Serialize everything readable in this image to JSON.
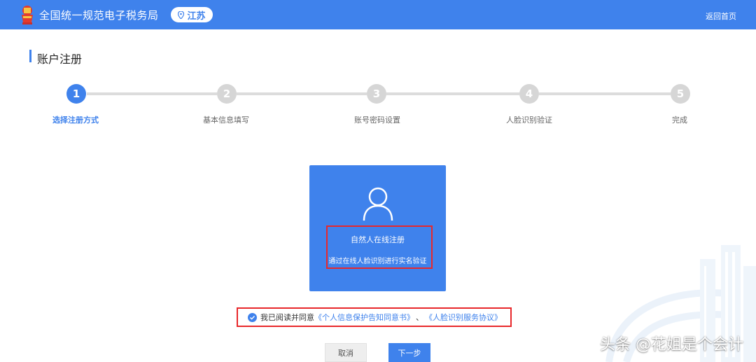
{
  "header": {
    "site_title": "全国统一规范电子税务局",
    "region": "江苏",
    "home_link": "返回首页"
  },
  "page": {
    "title": "账户注册"
  },
  "steps": [
    {
      "number": "1",
      "label": "选择注册方式",
      "active": true
    },
    {
      "number": "2",
      "label": "基本信息填写",
      "active": false
    },
    {
      "number": "3",
      "label": "账号密码设置",
      "active": false
    },
    {
      "number": "4",
      "label": "人脸识别验证",
      "active": false
    },
    {
      "number": "5",
      "label": "完成",
      "active": false
    }
  ],
  "card": {
    "title": "自然人在线注册",
    "subtitle": "通过在线人脸识别进行实名验证"
  },
  "agreement": {
    "prefix": "我已阅读并同意",
    "link1": "《个人信息保护告知同意书》",
    "separator": "、",
    "link2": "《人脸识别服务协议》"
  },
  "buttons": {
    "cancel": "取消",
    "next": "下一步"
  },
  "watermark": "头条 @花姐是个会计",
  "colors": {
    "primary": "#3f82ec",
    "highlight": "#e8282b",
    "inactive_step": "#d6d6d6"
  }
}
